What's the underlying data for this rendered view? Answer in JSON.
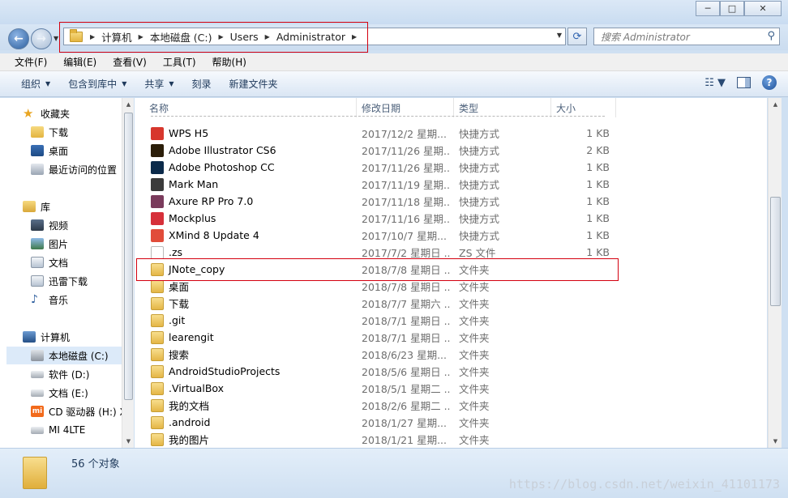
{
  "window": {
    "min_glyph": "─",
    "max_glyph": "□",
    "close_glyph": "✕"
  },
  "address": {
    "crumbs": [
      "计算机",
      "本地磁盘 (C:)",
      "Users",
      "Administrator"
    ],
    "search_placeholder": "搜索 Administrator"
  },
  "menu": [
    "文件(F)",
    "编辑(E)",
    "查看(V)",
    "工具(T)",
    "帮助(H)"
  ],
  "toolbar": [
    "组织",
    "包含到库中",
    "共享",
    "刻录",
    "新建文件夹"
  ],
  "nav": {
    "favorites": "收藏夹",
    "favorites_items": [
      "下载",
      "桌面",
      "最近访问的位置"
    ],
    "libraries": "库",
    "library_items": [
      "视频",
      "图片",
      "文档",
      "迅雷下载",
      "音乐"
    ],
    "computer": "计算机",
    "computer_items": [
      "本地磁盘 (C:)",
      "软件 (D:)",
      "文档 (E:)",
      "CD 驱动器 (H:) X",
      "MI 4LTE"
    ]
  },
  "columns": [
    "名称",
    "修改日期",
    "类型",
    "大小"
  ],
  "files": [
    {
      "name": "WPS H5",
      "date": "2017/12/2 星期...",
      "type": "快捷方式",
      "size": "1 KB",
      "icon": "wps-icon",
      "color": "#d7372d"
    },
    {
      "name": "Adobe Illustrator CS6",
      "date": "2017/11/26 星期...",
      "type": "快捷方式",
      "size": "2 KB",
      "icon": "illustrator-icon",
      "color": "#2b1e09"
    },
    {
      "name": "Adobe Photoshop CC",
      "date": "2017/11/26 星期...",
      "type": "快捷方式",
      "size": "1 KB",
      "icon": "photoshop-icon",
      "color": "#0b2a4a"
    },
    {
      "name": "Mark Man",
      "date": "2017/11/19 星期...",
      "type": "快捷方式",
      "size": "1 KB",
      "icon": "markman-icon",
      "color": "#3b3b3b"
    },
    {
      "name": "Axure RP Pro 7.0",
      "date": "2017/11/18 星期...",
      "type": "快捷方式",
      "size": "1 KB",
      "icon": "axure-icon",
      "color": "#7a3b5c"
    },
    {
      "name": "Mockplus",
      "date": "2017/11/16 星期...",
      "type": "快捷方式",
      "size": "1 KB",
      "icon": "mockplus-icon",
      "color": "#d6303a"
    },
    {
      "name": "XMind 8 Update 4",
      "date": "2017/10/7 星期...",
      "type": "快捷方式",
      "size": "1 KB",
      "icon": "xmind-icon",
      "color": "#e14c3a"
    },
    {
      "name": ".zs",
      "date": "2017/7/2 星期日 ...",
      "type": "ZS 文件",
      "size": "1 KB",
      "icon": "file-icon",
      "color": "#ffffff"
    },
    {
      "name": "JNote_copy",
      "date": "2018/7/8 星期日 ...",
      "type": "文件夹",
      "size": "",
      "icon": "folder-icon",
      "color": "#e4b646"
    },
    {
      "name": "桌面",
      "date": "2018/7/8 星期日 ...",
      "type": "文件夹",
      "size": "",
      "icon": "desktop-folder-icon",
      "color": "#5d8fd1"
    },
    {
      "name": "下载",
      "date": "2018/7/7 星期六 ...",
      "type": "文件夹",
      "size": "",
      "icon": "downloads-folder-icon",
      "color": "#3d7fd1"
    },
    {
      "name": ".git",
      "date": "2018/7/1 星期日 ...",
      "type": "文件夹",
      "size": "",
      "icon": "folder-icon",
      "color": "#e4b646"
    },
    {
      "name": "learengit",
      "date": "2018/7/1 星期日 ...",
      "type": "文件夹",
      "size": "",
      "icon": "folder-icon",
      "color": "#e4b646"
    },
    {
      "name": "搜索",
      "date": "2018/6/23 星期...",
      "type": "文件夹",
      "size": "",
      "icon": "searches-folder-icon",
      "color": "#e4b646"
    },
    {
      "name": "AndroidStudioProjects",
      "date": "2018/5/6 星期日 ...",
      "type": "文件夹",
      "size": "",
      "icon": "folder-icon",
      "color": "#e4b646"
    },
    {
      "name": ".VirtualBox",
      "date": "2018/5/1 星期二 ...",
      "type": "文件夹",
      "size": "",
      "icon": "folder-icon",
      "color": "#e4b646"
    },
    {
      "name": "我的文档",
      "date": "2018/2/6 星期二 ...",
      "type": "文件夹",
      "size": "",
      "icon": "documents-folder-icon",
      "color": "#e4b646"
    },
    {
      "name": ".android",
      "date": "2018/1/27 星期...",
      "type": "文件夹",
      "size": "",
      "icon": "folder-icon",
      "color": "#e4b646"
    },
    {
      "name": "我的图片",
      "date": "2018/1/21 星期...",
      "type": "文件夹",
      "size": "",
      "icon": "pictures-folder-icon",
      "color": "#e4b646"
    }
  ],
  "status": "56 个对象",
  "watermark": "https://blog.csdn.net/weixin_41101173"
}
